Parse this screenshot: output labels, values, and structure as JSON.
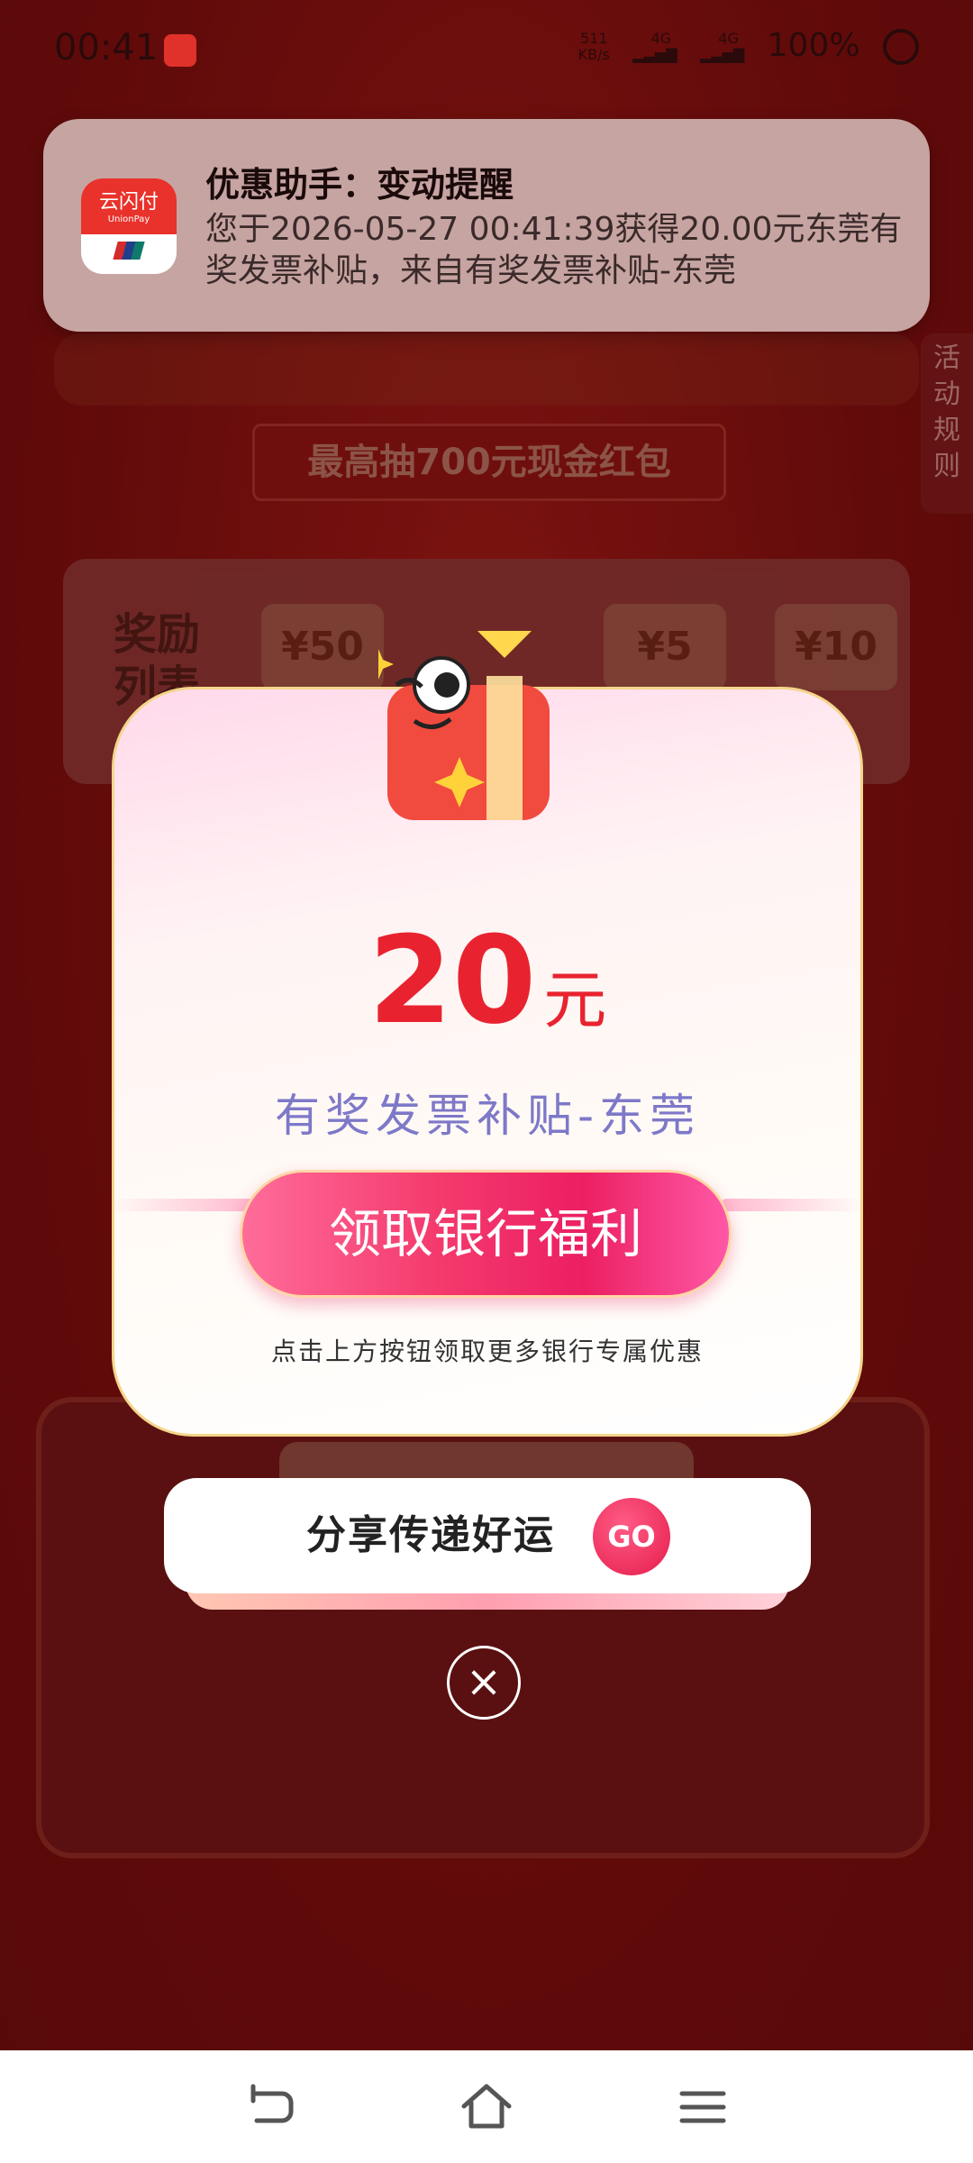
{
  "status_bar": {
    "time": "00:41",
    "speed_value": "511",
    "speed_unit": "KB/s",
    "network_1": "4G",
    "network_2": "4G",
    "battery": "100%"
  },
  "notification": {
    "app_icon_text": "云闪付",
    "app_icon_sub": "UnionPay",
    "title": "优惠助手：变动提醒",
    "body": "您于2026-05-27 00:41:39获得20.00元东莞有奖发票补贴，来自有奖发票补贴-东莞"
  },
  "background": {
    "banner_text": "最高抽700元现金红包",
    "rules_tab": [
      "活",
      "动",
      "规",
      "则"
    ],
    "reward_list_label": "奖励列表",
    "reward_chips": [
      "¥50",
      "¥5",
      "¥10"
    ]
  },
  "modal": {
    "amount": "20",
    "unit": "元",
    "subtitle": "有奖发票补贴-东莞",
    "claim_button": "领取银行福利",
    "hint": "点击上方按钮领取更多银行专属优惠"
  },
  "share": {
    "label": "分享传递好运",
    "go": "GO"
  },
  "close_symbol": "×",
  "colors": {
    "accent_red": "#e8232f",
    "subtitle_purple": "#7d78c8",
    "button_pink": "#ec1f62"
  },
  "icons": [
    "back-icon",
    "home-icon",
    "menu-icon",
    "close-icon",
    "gift-box-icon"
  ]
}
